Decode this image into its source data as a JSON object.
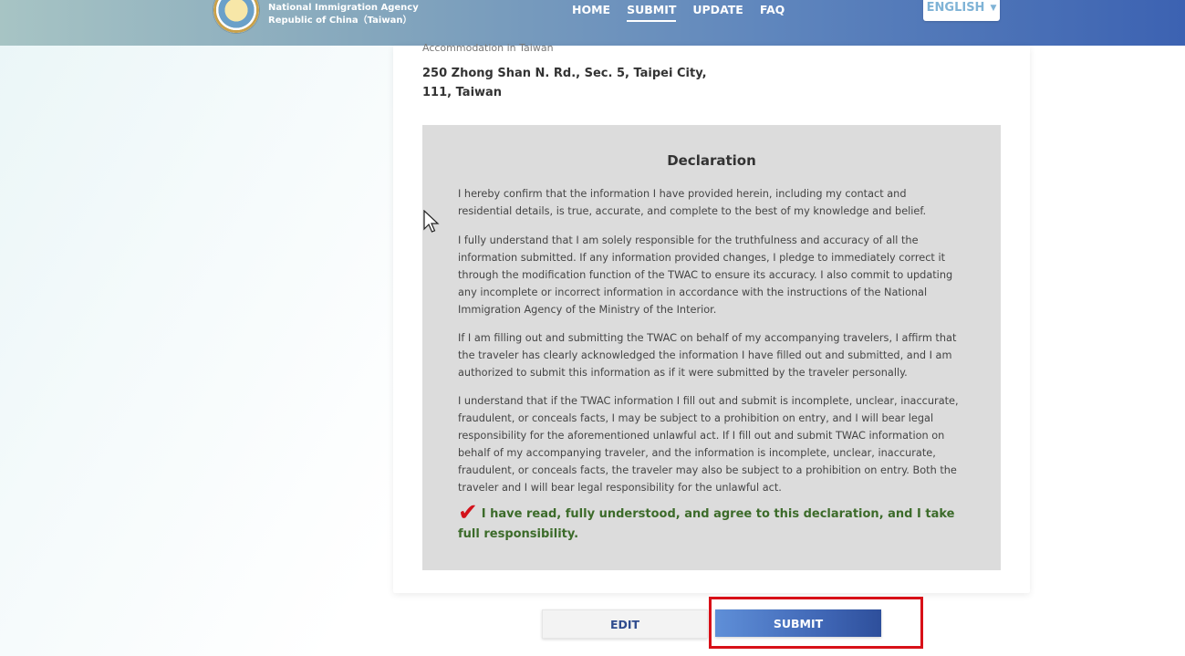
{
  "header": {
    "agency_line1": "National Immigration Agency",
    "agency_line2": "Republic of China（Taiwan）",
    "nav": [
      {
        "label": "HOME",
        "active": false
      },
      {
        "label": "SUBMIT",
        "active": true
      },
      {
        "label": "UPDATE",
        "active": false
      },
      {
        "label": "FAQ",
        "active": false
      }
    ],
    "language": "ENGLISH"
  },
  "accommodation": {
    "label": "Accommodation in Taiwan",
    "value": "250 Zhong Shan N. Rd., Sec. 5, Taipei City, 111, Taiwan"
  },
  "declaration": {
    "title": "Declaration",
    "paragraphs": [
      "I hereby confirm that the information I have provided herein, including my contact and residential details, is true, accurate, and complete to the best of my knowledge and belief.",
      "I fully understand that I am solely responsible for the truthfulness and accuracy of all the information submitted. If any information provided changes, I pledge to immediately correct it through the modification function of the TWAC to ensure its accuracy. I also commit to updating any incomplete or incorrect information in accordance with the instructions of the National Immigration Agency of the Ministry of the Interior.",
      "If I am filling out and submitting the TWAC on behalf of my accompanying travelers, I affirm that the traveler has clearly acknowledged the information I have filled out and submitted, and I am authorized to submit this information as if it were submitted by the traveler personally.",
      "I understand that if the TWAC information I fill out and submit is incomplete, unclear, inaccurate, fraudulent, or conceals facts, I may be subject to a prohibition on entry, and I will bear legal responsibility for the aforementioned unlawful act. If I fill out and submit TWAC information on behalf of my accompanying traveler, and the information is incomplete, unclear, inaccurate, fraudulent, or conceals facts, the traveler may also be subject to a prohibition on entry. Both the traveler and I will bear legal responsibility for the unlawful act."
    ],
    "agree_text": "I have read, fully understood, and agree to this declaration, and I take full responsibility.",
    "agree_checked": true
  },
  "buttons": {
    "edit": "EDIT",
    "submit": "SUBMIT"
  },
  "colors": {
    "accent": "#3d63b2",
    "agree_text": "#3c6b2a",
    "checkmark": "#d3121b",
    "highlight_box": "#d81018"
  }
}
